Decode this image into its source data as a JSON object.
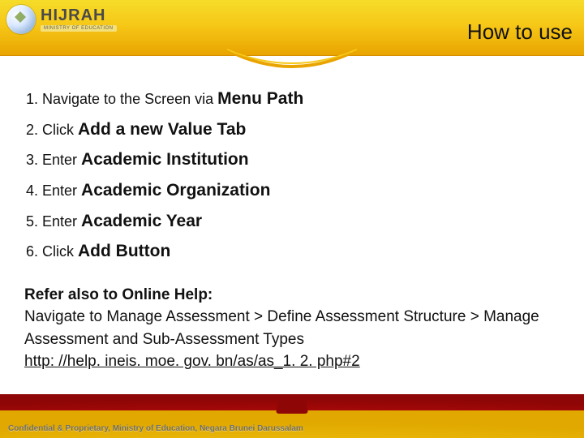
{
  "brand": {
    "name": "HIJRAH",
    "tagline": "MINISTRY OF EDUCATION"
  },
  "title": "How to use",
  "steps": [
    {
      "prefix": "Navigate to the Screen via ",
      "emphasis": "Menu Path"
    },
    {
      "prefix": "Click ",
      "emphasis": "Add a new Value Tab"
    },
    {
      "prefix": "Enter ",
      "emphasis": "Academic Institution"
    },
    {
      "prefix": "Enter ",
      "emphasis": "Academic Organization"
    },
    {
      "prefix": "Enter ",
      "emphasis": "Academic Year"
    },
    {
      "prefix": "Click ",
      "emphasis": "Add Button"
    }
  ],
  "help": {
    "heading": "Refer also to Online Help:",
    "path": "Navigate to Manage Assessment > Define Assessment Structure > Manage Assessment and Sub-Assessment Types",
    "url": "http: //help. ineis. moe. gov. bn/as/as_1. 2. php#2"
  },
  "footer": {
    "copyright": "Confidential & Proprietary, Ministry of Education, Negara Brunei Darussalam"
  }
}
